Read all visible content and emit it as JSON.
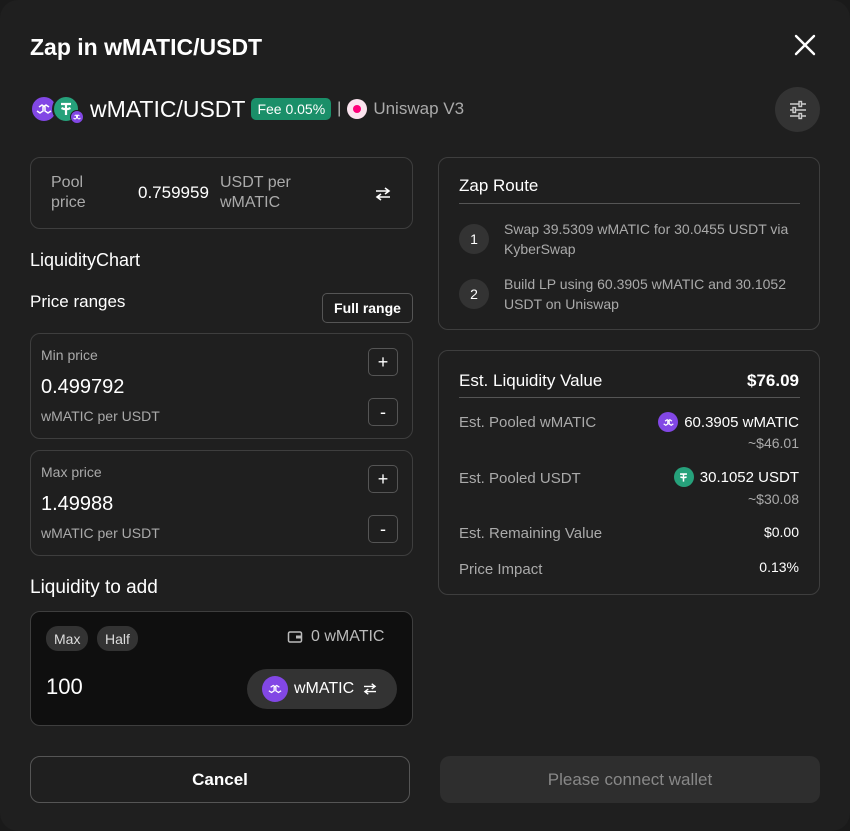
{
  "modal": {
    "title": "Zap in wMATIC/USDT",
    "pair": "wMATIC/USDT",
    "fee": "Fee 0.05%",
    "separator": "|",
    "protocol": "Uniswap V3"
  },
  "pool_price": {
    "label": "Pool price",
    "value": "0.759959",
    "unit": "USDT per wMATIC"
  },
  "chart": {
    "label": "LiquidityChart"
  },
  "price_ranges": {
    "label": "Price ranges",
    "full_range": "Full range",
    "min": {
      "label": "Min price",
      "value": "0.499792",
      "unit": "wMATIC per USDT"
    },
    "max": {
      "label": "Max price",
      "value": "1.49988",
      "unit": "wMATIC per USDT"
    },
    "plus": "+",
    "minus": "-"
  },
  "liquidity": {
    "label": "Liquidity to add",
    "max": "Max",
    "half": "Half",
    "balance": "0 wMATIC",
    "amount": "100",
    "token": "wMATIC"
  },
  "zap_route": {
    "title": "Zap Route",
    "steps": [
      {
        "num": "1",
        "text": "Swap 39.5309 wMATIC for 30.0455 USDT via KyberSwap"
      },
      {
        "num": "2",
        "text": "Build LP using 60.3905 wMATIC and 30.1052 USDT on Uniswap"
      }
    ]
  },
  "estimates": {
    "title": "Est. Liquidity Value",
    "total": "$76.09",
    "rows": [
      {
        "label": "Est. Pooled wMATIC",
        "value": "60.3905 wMATIC",
        "sub": "~$46.01"
      },
      {
        "label": "Est. Pooled USDT",
        "value": "30.1052 USDT",
        "sub": "~$30.08"
      },
      {
        "label": "Est. Remaining Value",
        "value": "$0.00"
      },
      {
        "label": "Price Impact",
        "value": "0.13%"
      }
    ]
  },
  "buttons": {
    "cancel": "Cancel",
    "connect": "Please connect wallet"
  },
  "colors": {
    "background": "#1f1f1f",
    "accent_green": "#1a8f69",
    "matic_purple": "#8247e5",
    "usdt_green": "#26a17b"
  },
  "icons": [
    "close-icon",
    "settings-sliders-icon",
    "swap-arrows-icon",
    "wallet-icon",
    "matic-token-icon",
    "usdt-token-icon",
    "uniswap-logo"
  ]
}
